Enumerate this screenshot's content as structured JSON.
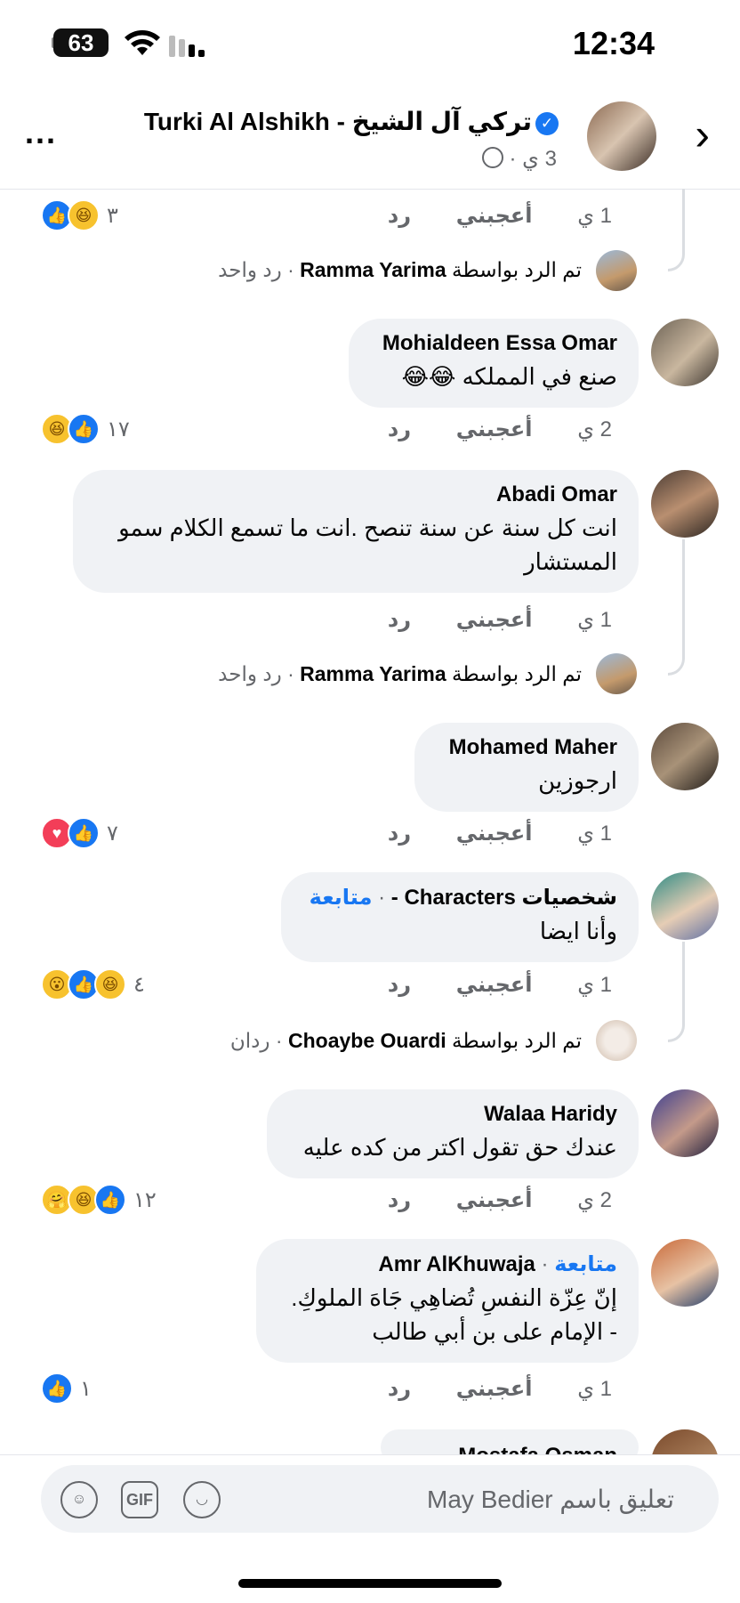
{
  "status": {
    "time": "12:34",
    "battery": "63"
  },
  "header": {
    "title": "تركي آل الشيخ - Turki Al Alshikh",
    "subtitle": "3 ي ·",
    "more_label": "..."
  },
  "comments": [
    {
      "actions": {
        "age": "1 ي",
        "like": "أعجبني",
        "reply": "رد"
      },
      "reaction_count": "٣",
      "reply_info": {
        "prefix": "تم الرد بواسطة",
        "name": "Ramma Yarima",
        "suffix": "· رد واحد"
      }
    },
    {
      "name": "Mohialdeen Essa Omar",
      "text": "صنع في المملكه 😂😂",
      "actions": {
        "age": "2 ي",
        "like": "أعجبني",
        "reply": "رد"
      },
      "reaction_count": "١٧"
    },
    {
      "name": "Abadi Omar",
      "text": "انت كل سنة عن سنة تنصح .انت ما تسمع الكلام سمو المستشار",
      "actions": {
        "age": "1 ي",
        "like": "أعجبني",
        "reply": "رد"
      },
      "reply_info": {
        "prefix": "تم الرد بواسطة",
        "name": "Ramma Yarima",
        "suffix": "· رد واحد"
      }
    },
    {
      "name": "Mohamed Maher",
      "text": "ارجوزين",
      "actions": {
        "age": "1 ي",
        "like": "أعجبني",
        "reply": "رد"
      },
      "reaction_count": "٧"
    },
    {
      "name": "شخصيات Characters -",
      "follow": "متابعة",
      "text": "وأنا ايضا",
      "actions": {
        "age": "1 ي",
        "like": "أعجبني",
        "reply": "رد"
      },
      "reaction_count": "٤",
      "reply_info": {
        "prefix": "تم الرد بواسطة",
        "name": "Choaybe Ouardi",
        "suffix": "· ردان"
      }
    },
    {
      "name": "Walaa Haridy",
      "text": "عندك حق تقول اكتر من كده عليه",
      "actions": {
        "age": "2 ي",
        "like": "أعجبني",
        "reply": "رد"
      },
      "reaction_count": "١٢"
    },
    {
      "name": "Amr AlKhuwaja",
      "follow": "متابعة",
      "text_line1": "إنّ عِزّة النفسِ تُضاهِي جَاهَ الملوكِ.",
      "text_line2": "- الإمام على بن أبي طالب",
      "actions": {
        "age": "1 ي",
        "like": "أعجبني",
        "reply": "رد"
      },
      "reaction_count": "١"
    },
    {
      "name": "Mostafa Osman"
    }
  ],
  "composer": {
    "placeholder": "تعليق باسم May Bedier",
    "gif_label": "GIF"
  },
  "colors": {
    "accent": "#1877f2",
    "bubble": "#f0f2f5",
    "muted": "#65676b"
  }
}
